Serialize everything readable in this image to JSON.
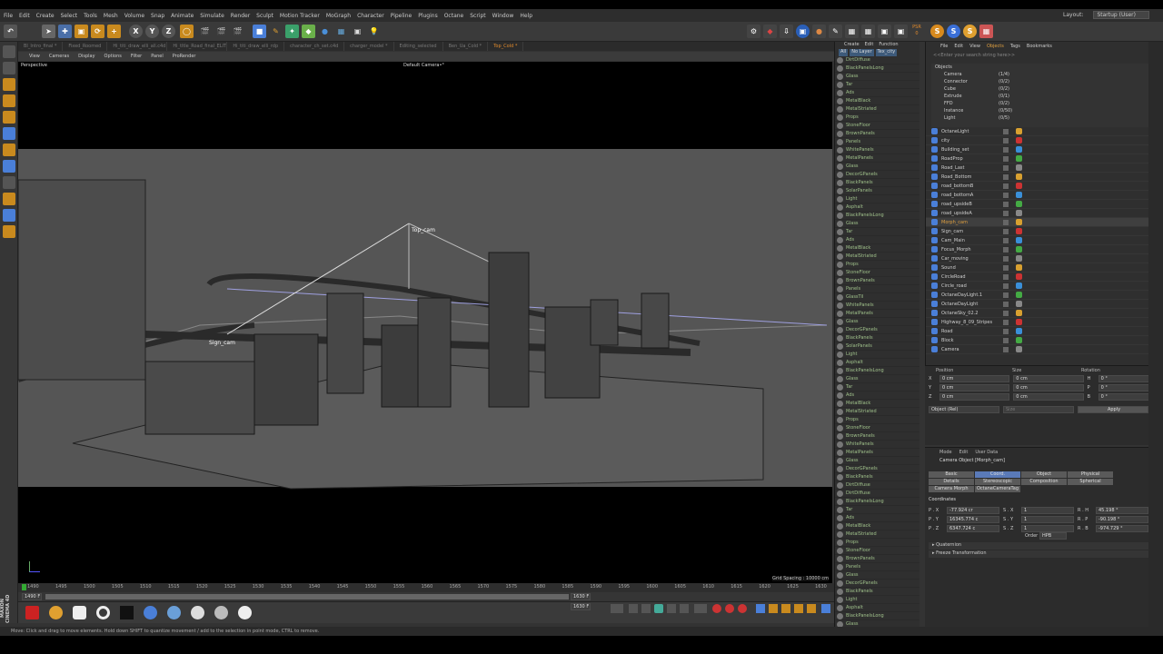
{
  "menu": [
    "File",
    "Edit",
    "Create",
    "Select",
    "Tools",
    "Mesh",
    "Volume",
    "Snap",
    "Animate",
    "Simulate",
    "Render",
    "Sculpt",
    "Motion Tracker",
    "MoGraph",
    "Character",
    "Pipeline",
    "Plugins",
    "Octane",
    "Script",
    "Window",
    "Help"
  ],
  "layout": {
    "label": "Layout:",
    "value": "Startup (User)"
  },
  "toolbar": {
    "x": "X",
    "y": "Y",
    "z": "Z",
    "counter": "0",
    "psr": "PSR"
  },
  "tabs": [
    "BI_Intro_final *",
    "Fixed_Roomed",
    "Hi_titi_draw_elli_all.c4d",
    "Hi_tltle_Road_final_ELITE",
    "Hi_titi_draw_elli_rdp",
    "character_ch_set.c4d",
    "charger_model *",
    "Editing_selected",
    "Ben_Ua_Cold *",
    "Top_Cold *"
  ],
  "viewport": {
    "menu": [
      "View",
      "Cameras",
      "Display",
      "Options",
      "Filter",
      "Panel",
      "ProRender"
    ],
    "label": "Perspective",
    "camera": "Default Camera•°",
    "grid": "Grid Spacing : 10000 cm",
    "top_cam": "Top_cam",
    "sign_cam": "Sign_cam"
  },
  "timeline": {
    "ticks": [
      "1490",
      "1495",
      "1500",
      "1505",
      "1510",
      "1515",
      "1520",
      "1525",
      "1530",
      "1535",
      "1540",
      "1545",
      "1550",
      "1555",
      "1560",
      "1565",
      "1570",
      "1575",
      "1580",
      "1585",
      "1590",
      "1595",
      "1600",
      "1605",
      "1610",
      "1615",
      "1620",
      "1625",
      "1630"
    ],
    "start": "1490 F",
    "end": "1630 F",
    "current": "1630 F"
  },
  "status": "Move: Click and drag to move elements. Hold down SHIFT to quantize movement / add to the selection in point mode, CTRL to remove.",
  "layers": {
    "menu": [
      "Create",
      "Edit",
      "Function"
    ],
    "filter": [
      "All",
      "No Layer",
      "Tex_city"
    ],
    "materials": [
      "DirtDiffuse",
      "BlackPanelsLong",
      "Glass",
      "Tar",
      "Ads",
      "MetalBlack",
      "MetalStriated",
      "Props",
      "StoneFloor",
      "BrownPanels",
      "Panels",
      "WhitePanels",
      "MetalPanels",
      "Glass",
      "DecorGPanels",
      "BlackPanels",
      "SolarPanels",
      "Light",
      "Asphalt",
      "BlackPanelsLong",
      "Glass",
      "Tar",
      "Ads",
      "MetalBlack",
      "MetalStriated",
      "Props",
      "StoneFloor",
      "BrownPanels",
      "Panels",
      "GlassTil",
      "WhitePanels",
      "MetalPanels",
      "Glass",
      "DecorGPanels",
      "BlackPanels",
      "SolarPanels",
      "Light",
      "Asphalt",
      "BlackPanelsLong",
      "Glass",
      "Tar",
      "Ads",
      "MetalBlack",
      "MetalStriated",
      "Props",
      "StoneFloor",
      "BrownPanels",
      "WhitePanels",
      "MetalPanels",
      "Glass",
      "DecorGPanels",
      "BlackPanels",
      "DirtDiffuse",
      "DirtDiffuse",
      "BlackPanelsLong",
      "Tar",
      "Ads",
      "MetalBlack",
      "MetalStriated",
      "Props",
      "StoneFloor",
      "BrownPanels",
      "Panels",
      "Glass",
      "DecorGPanels",
      "BlackPanels",
      "Light",
      "Asphalt",
      "BlackPanelsLong",
      "Glass",
      "Tar",
      "Ads",
      "MetalBlack",
      "MetalStriated"
    ]
  },
  "objects": {
    "menu": [
      "File",
      "Edit",
      "View",
      "Objects",
      "Tags",
      "Bookmarks"
    ],
    "search": "<<Enter your search string here>>",
    "filter": [
      {
        "name": "Objects",
        "count": ""
      },
      {
        "name": "Camera",
        "count": "(1/4)"
      },
      {
        "name": "Connector",
        "count": "(0/2)"
      },
      {
        "name": "Cube",
        "count": "(0/2)"
      },
      {
        "name": "Extrude",
        "count": "(0/1)"
      },
      {
        "name": "FFD",
        "count": "(0/2)"
      },
      {
        "name": "Instance",
        "count": "(0/50)"
      },
      {
        "name": "Light",
        "count": "(0/5)"
      }
    ],
    "rows": [
      "OctaneLight",
      "city",
      "Building_set",
      "RoadProp",
      "Road_Last",
      "Road_Bottom",
      "road_bottomB",
      "road_bottomA",
      "road_upsideB",
      "road_upsideA",
      "Morph_cam",
      "Sign_cam",
      "Cam_Main",
      "Focus_Morph",
      "Car_moving",
      "Sound",
      "CircleRoad",
      "Circle_road",
      "OctaneDayLight.1",
      "OctaneDayLight",
      "OctaneSky_02.2",
      "Highway_8_09_Stripes",
      "Road",
      "Block",
      "Camera"
    ]
  },
  "coords": {
    "headers": [
      "Position",
      "Size",
      "Rotation"
    ],
    "rows": [
      {
        "a": "X",
        "pos": "0 cm",
        "size": "0 cm",
        "r": "H",
        "rot": "0 °"
      },
      {
        "a": "Y",
        "pos": "0 cm",
        "size": "0 cm",
        "r": "P",
        "rot": "0 °"
      },
      {
        "a": "Z",
        "pos": "0 cm",
        "size": "0 cm",
        "r": "B",
        "rot": "0 °"
      }
    ],
    "mode": "Object (Rel)",
    "size_mode": "Size",
    "apply": "Apply"
  },
  "attributes": {
    "menu": [
      "Mode",
      "Edit",
      "User Data"
    ],
    "title": "Camera Object [Morph_cam]",
    "tabs": [
      "Basic",
      "Coord.",
      "Object",
      "Physical",
      "Details",
      "Stereoscopic",
      "Composition",
      "Spherical",
      "Camera Morph",
      "OctaneCameraTag"
    ],
    "section": "Coordinates",
    "p": [
      {
        "l": "P . X",
        "v": "-77.924 cr"
      },
      {
        "l": "P . Y",
        "v": "16345.774 c"
      },
      {
        "l": "P . Z",
        "v": "6347.724 c"
      }
    ],
    "s": [
      {
        "l": "S . X",
        "v": "1"
      },
      {
        "l": "S . Y",
        "v": "1"
      },
      {
        "l": "S . Z",
        "v": "1"
      }
    ],
    "r": [
      {
        "l": "R . H",
        "v": "45.198 °"
      },
      {
        "l": "R . P",
        "v": "-90.198 °"
      },
      {
        "l": "R . B",
        "v": "-974.729 °"
      }
    ],
    "order_label": "Order",
    "order": "HPB",
    "quaternion": "▸ Quaternion",
    "freeze": "▸ Freeze Transformation"
  },
  "brand": "MAXON CINEMA 4D"
}
